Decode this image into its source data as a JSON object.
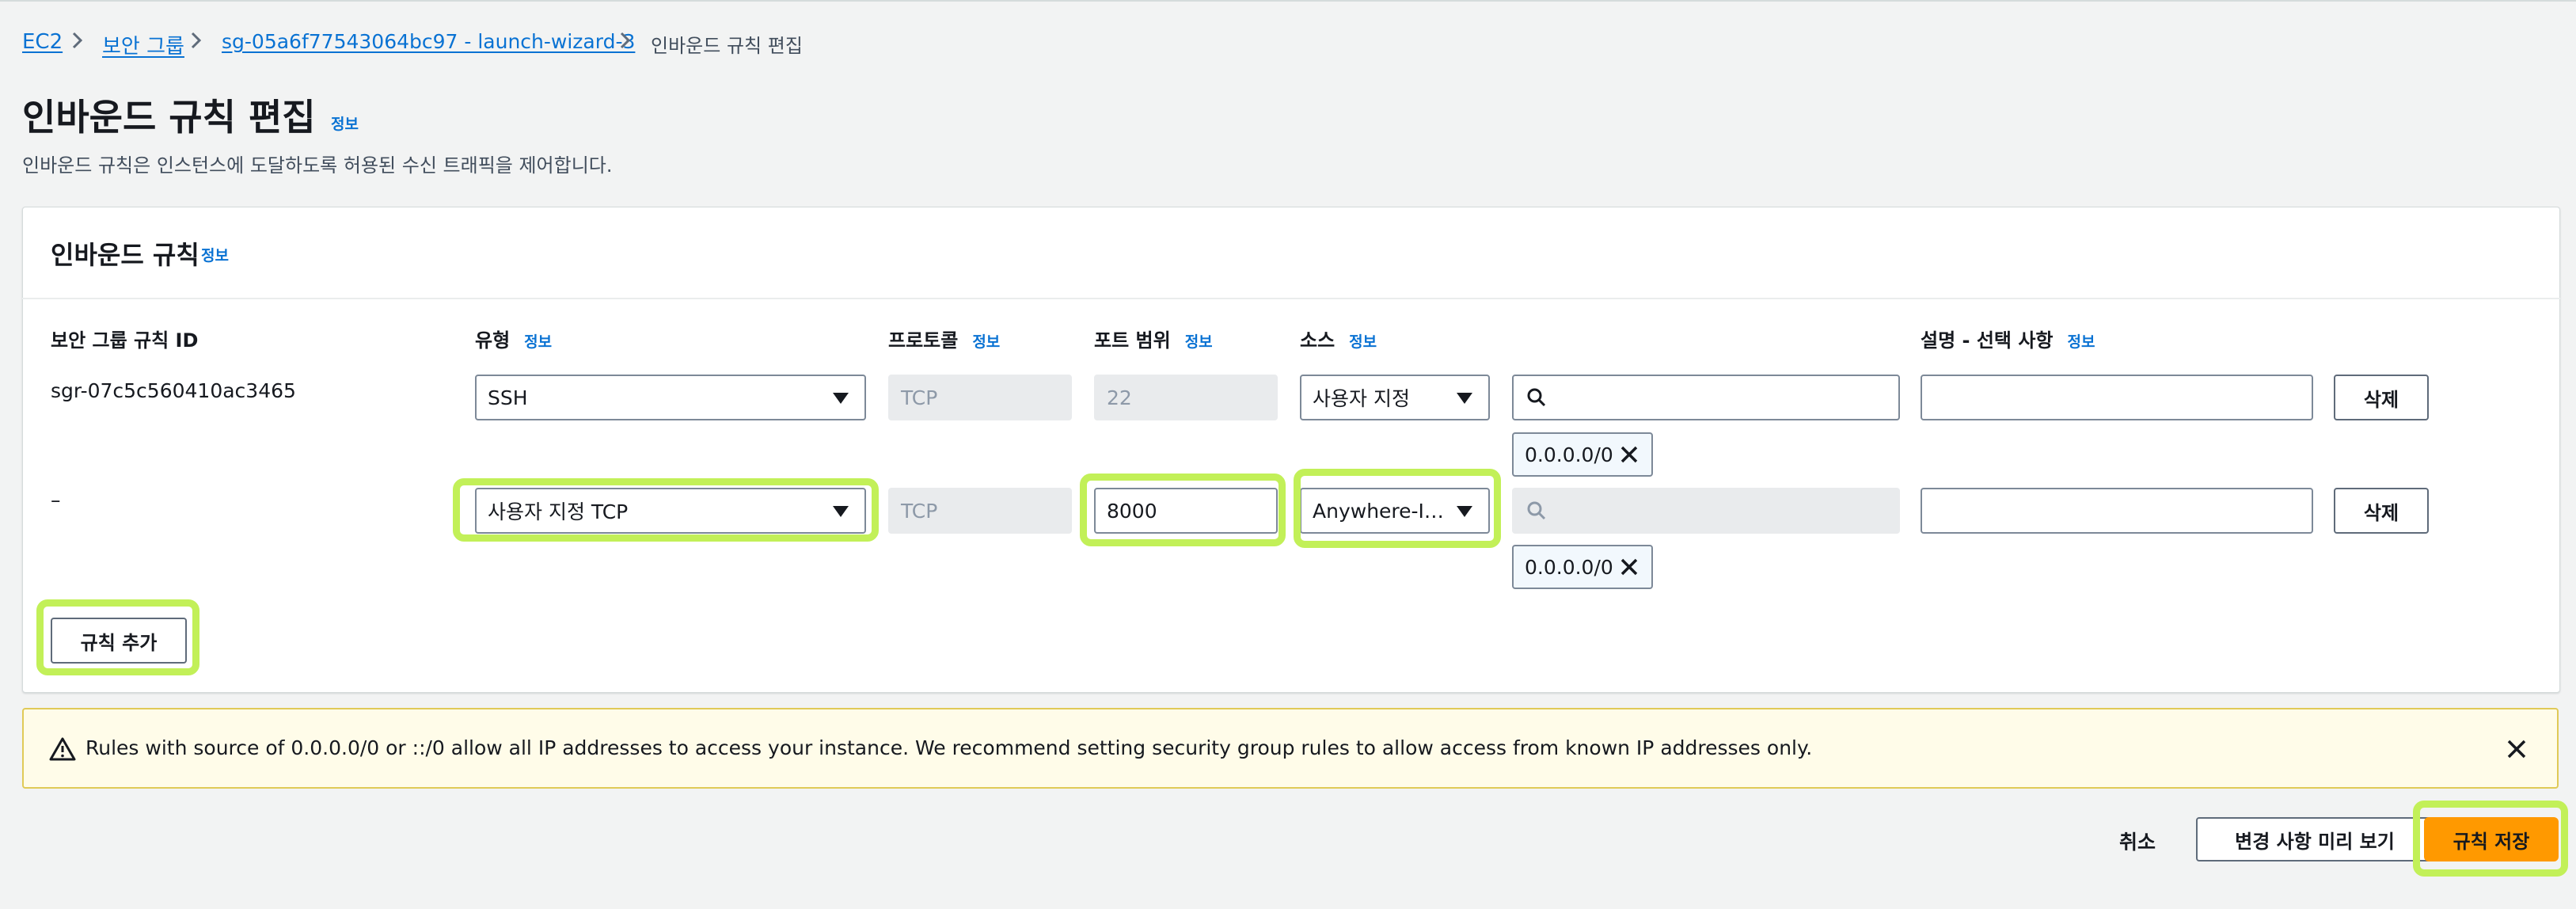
{
  "breadcrumb": {
    "items": [
      "EC2",
      "보안 그룹",
      "sg-05a6f77543064bc97 - launch-wizard-3"
    ],
    "current": "인바운드 규칙 편집"
  },
  "page": {
    "title": "인바운드 규칙 편집",
    "info": "정보",
    "description": "인바운드 규칙은 인스턴스에 도달하도록 허용된 수신 트래픽을 제어합니다."
  },
  "panel": {
    "title": "인바운드 규칙",
    "info": "정보",
    "columns": {
      "rule_id": "보안 그룹 규칙 ID",
      "type": "유형",
      "protocol": "프로토콜",
      "port": "포트 범위",
      "source": "소스",
      "description": "설명 - 선택 사항",
      "info": "정보"
    },
    "rows": [
      {
        "rule_id": "sgr-07c5c560410ac3465",
        "type": "SSH",
        "protocol": "TCP",
        "port": "22",
        "source": "사용자 지정",
        "search_value": "",
        "token": "0.0.0.0/0",
        "description": "",
        "delete_label": "삭제"
      },
      {
        "rule_id": "–",
        "type": "사용자 지정 TCP",
        "protocol": "TCP",
        "port": "8000",
        "source": "Anywhere-I…",
        "search_value": "",
        "token": "0.0.0.0/0",
        "description": "",
        "delete_label": "삭제"
      }
    ],
    "add_rule_label": "규칙 추가"
  },
  "alert": {
    "message": "Rules with source of 0.0.0.0/0 or ::/0 allow all IP addresses to access your instance. We recommend setting security group rules to allow access from known IP addresses only."
  },
  "footer": {
    "cancel_label": "취소",
    "preview_label": "변경 사항 미리 보기",
    "save_label": "규칙 저장"
  },
  "colors": {
    "link": "#0972d3",
    "primary": "#ff9900",
    "highlight": "#c2f058",
    "warning": "#e0ca57"
  },
  "icons": [
    "chevron-right-icon",
    "caret-down-icon",
    "search-icon",
    "close-icon",
    "warning-icon"
  ]
}
